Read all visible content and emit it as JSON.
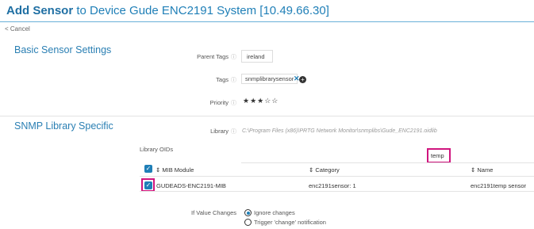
{
  "header": {
    "title_bold": "Add Sensor",
    "title_rest": " to Device Gude ENC2191 System [10.49.66.30]"
  },
  "nav": {
    "cancel": "< Cancel"
  },
  "basic": {
    "section_title": "Basic Sensor Settings",
    "parent_tags_label": "Parent Tags",
    "parent_tags_value": "ireland",
    "tags_label": "Tags",
    "tag_chip": "snmplibrarysensor",
    "tag_remove": "✕",
    "tag_add": "+",
    "priority_label": "Priority",
    "priority_stars": "★★★☆☆",
    "priority_value": 3,
    "priority_max": 5
  },
  "snmp": {
    "section_title": "SNMP Library Specific",
    "library_label": "Library",
    "library_path": "C:\\Program Files (x86)\\PRTG Network Monitor\\snmplibs\\Gude_ENC2191.oidlib",
    "oids_label": "Library OIDs",
    "filter_value": "temp",
    "columns": {
      "mib": "MIB Module",
      "category": "Category",
      "name": "Name"
    },
    "rows": [
      {
        "mib": "GUDEADS-ENC2191-MIB",
        "category": "enc2191sensor: 1",
        "name": "enc2191temp sensor",
        "checked": true
      }
    ],
    "if_value_changes_label": "If Value Changes",
    "options": [
      {
        "label": "Ignore changes",
        "selected": true
      },
      {
        "label": "Trigger 'change' notification",
        "selected": false
      }
    ]
  },
  "colors": {
    "accent": "#1f7fb7",
    "highlight": "#d0157e"
  }
}
